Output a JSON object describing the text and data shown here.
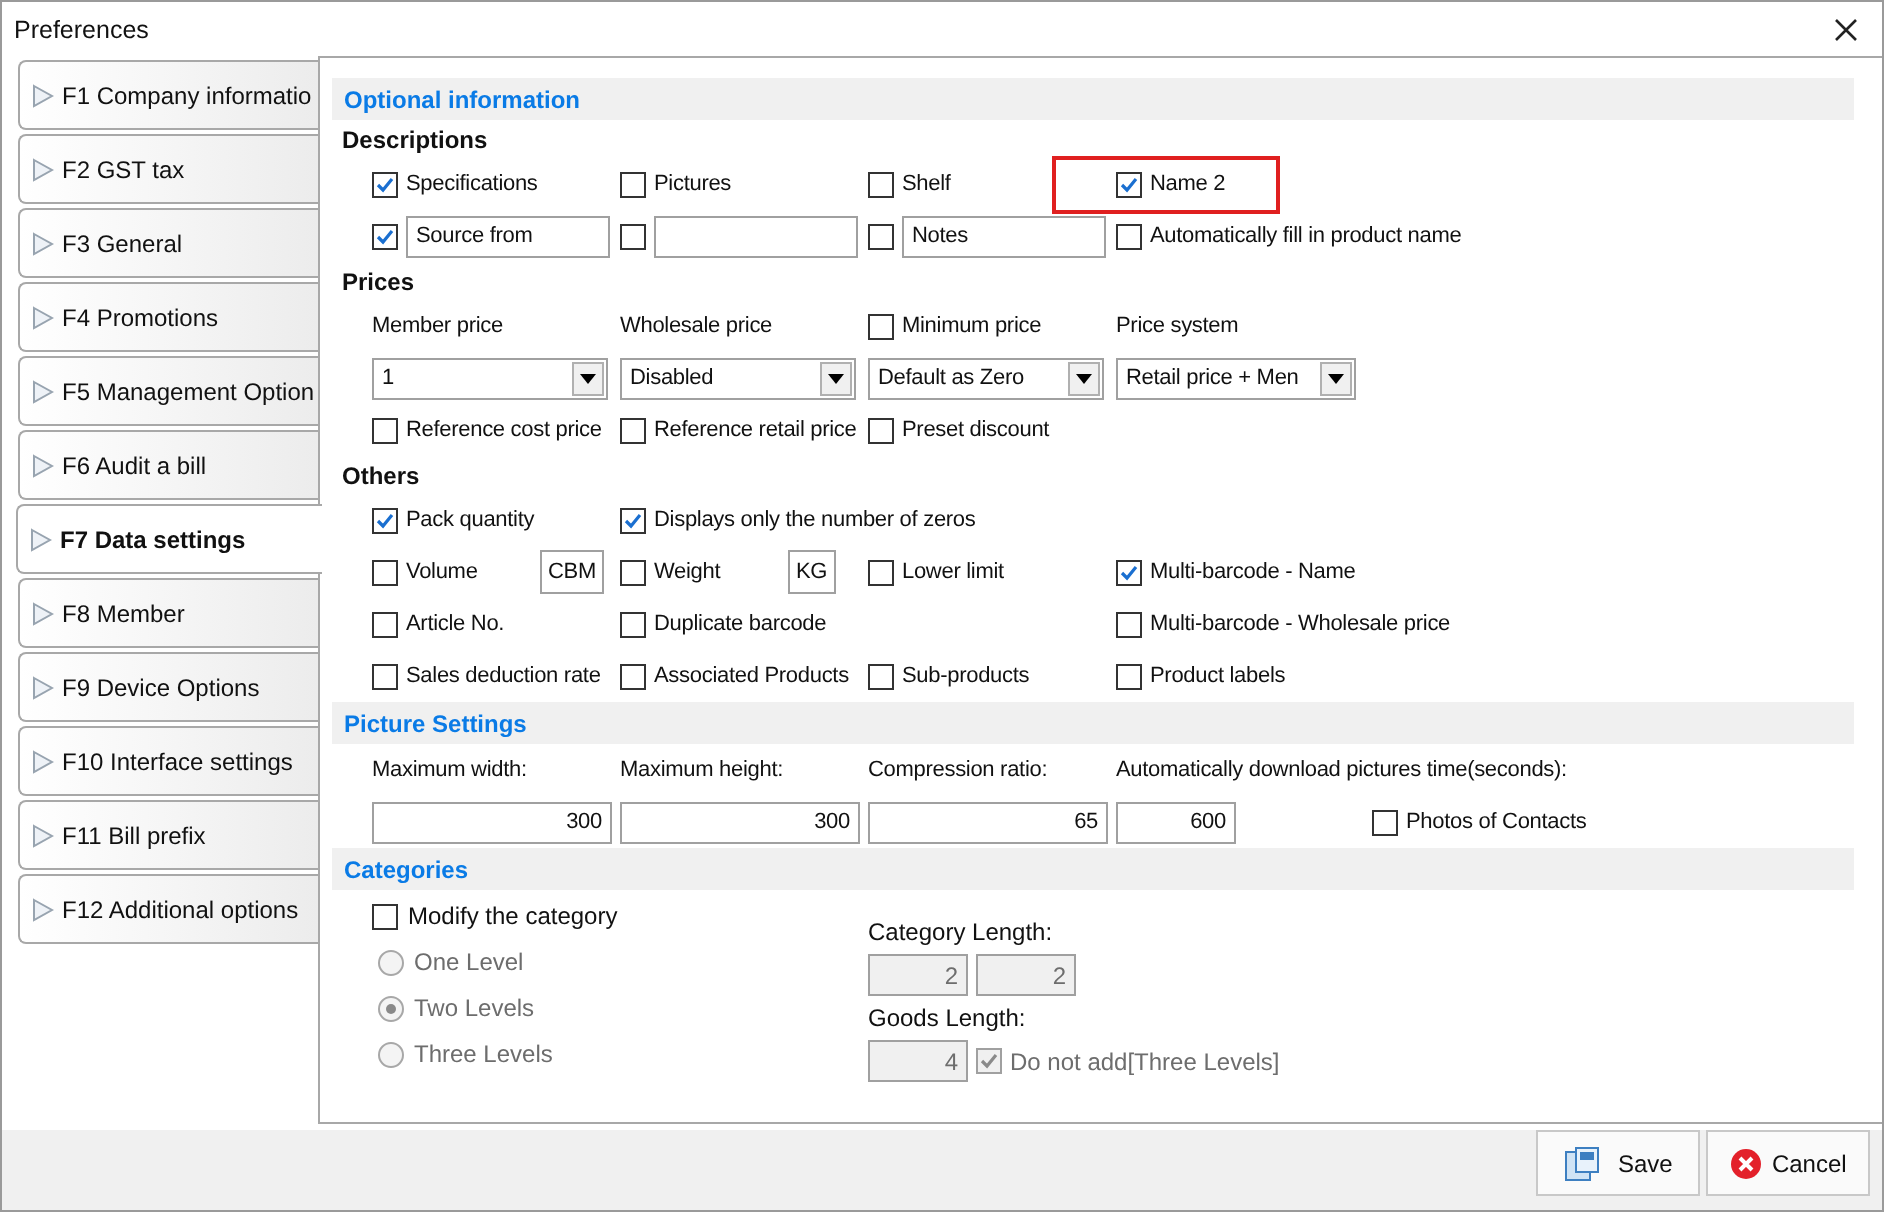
{
  "window": {
    "title": "Preferences"
  },
  "sidebar": {
    "items": [
      {
        "label": "F1 Company informatio",
        "selected": false
      },
      {
        "label": "F2 GST tax",
        "selected": false
      },
      {
        "label": "F3 General",
        "selected": false
      },
      {
        "label": "F4 Promotions",
        "selected": false
      },
      {
        "label": "F5 Management Option",
        "selected": false
      },
      {
        "label": "F6 Audit a bill",
        "selected": false
      },
      {
        "label": "F7 Data settings",
        "selected": true
      },
      {
        "label": "F8 Member",
        "selected": false
      },
      {
        "label": "F9 Device Options",
        "selected": false
      },
      {
        "label": "F10 Interface settings",
        "selected": false
      },
      {
        "label": "F11 Bill prefix",
        "selected": false
      },
      {
        "label": "F12 Additional options",
        "selected": false
      }
    ]
  },
  "sections": [
    {
      "kind": "grid",
      "title": "Optional information",
      "groups": [
        {
          "title": "Descriptions",
          "rows": [
            {
              "cells": [
                {
                  "kind": "check",
                  "label": "Specifications",
                  "checked": true
                },
                {
                  "kind": "check",
                  "label": "Pictures",
                  "checked": false
                },
                {
                  "kind": "check",
                  "label": "Shelf",
                  "checked": false
                },
                {
                  "kind": "check",
                  "label": "Name 2",
                  "checked": true,
                  "highlighted": true
                }
              ]
            },
            {
              "cells": [
                {
                  "kind": "checkfield",
                  "checked": true,
                  "value": "Source from"
                },
                {
                  "kind": "checkfield",
                  "checked": false
                },
                {
                  "kind": "checkfield",
                  "checked": false,
                  "value": "Notes"
                },
                {
                  "kind": "check",
                  "label": "Automatically fill in product name",
                  "checked": false
                }
              ]
            }
          ]
        },
        {
          "title": "Prices",
          "rows": [
            {
              "cells": [
                {
                  "kind": "label",
                  "text": "Member price"
                },
                {
                  "kind": "label",
                  "text": "Wholesale price"
                },
                {
                  "kind": "check",
                  "label": "Minimum price",
                  "checked": false
                },
                {
                  "kind": "label",
                  "text": "Price system"
                }
              ]
            },
            {
              "cells": [
                {
                  "kind": "combo",
                  "value": "1"
                },
                {
                  "kind": "combo",
                  "value": "Disabled"
                },
                {
                  "kind": "combo",
                  "value": "Default as Zero"
                },
                {
                  "kind": "combo",
                  "value": "Retail price + Men"
                }
              ]
            },
            {
              "cells": [
                {
                  "kind": "check",
                  "label": "Reference cost price",
                  "checked": false
                },
                {
                  "kind": "check",
                  "label": "Reference retail price",
                  "checked": false
                },
                {
                  "kind": "check",
                  "label": "Preset discount",
                  "checked": false
                }
              ]
            }
          ]
        },
        {
          "title": "Others",
          "rows": [
            {
              "cells": [
                {
                  "kind": "check",
                  "label": "Pack quantity",
                  "checked": true
                },
                {
                  "kind": "check",
                  "label": "Displays only the number of zeros",
                  "checked": true
                }
              ]
            },
            {
              "cells": [
                {
                  "kind": "checkunit",
                  "label": "Volume",
                  "checked": false,
                  "unit": "CBM"
                },
                {
                  "kind": "checkunit",
                  "label": "Weight",
                  "checked": false,
                  "unit": "KG"
                },
                {
                  "kind": "check",
                  "label": "Lower limit",
                  "checked": false
                },
                {
                  "kind": "check",
                  "label": "Multi-barcode - Name",
                  "checked": true
                }
              ]
            },
            {
              "cells": [
                {
                  "kind": "check",
                  "label": "Article No.",
                  "checked": false
                },
                {
                  "kind": "check",
                  "label": "Duplicate barcode",
                  "checked": false
                },
                {
                  "kind": "blank"
                },
                {
                  "kind": "check",
                  "label": "Multi-barcode - Wholesale price",
                  "checked": false
                }
              ]
            },
            {
              "cells": [
                {
                  "kind": "check",
                  "label": "Sales deduction rate",
                  "checked": false
                },
                {
                  "kind": "check",
                  "label": "Associated Products",
                  "checked": false
                },
                {
                  "kind": "check",
                  "label": "Sub-products",
                  "checked": false
                },
                {
                  "kind": "check",
                  "label": "Product labels",
                  "checked": false
                }
              ]
            }
          ]
        }
      ]
    },
    {
      "kind": "grid",
      "title": "Picture Settings",
      "groups": [
        {
          "rows": [
            {
              "cells": [
                {
                  "kind": "label",
                  "text": "Maximum width:"
                },
                {
                  "kind": "label",
                  "text": "Maximum height:"
                },
                {
                  "kind": "label",
                  "text": "Compression ratio:"
                },
                {
                  "kind": "label",
                  "text": "Automatically download pictures time(seconds):"
                }
              ]
            },
            {
              "cells": [
                {
                  "kind": "number",
                  "value": "300"
                },
                {
                  "kind": "number",
                  "value": "300"
                },
                {
                  "kind": "number",
                  "value": "65"
                },
                {
                  "kind": "numbercheck",
                  "value": "600",
                  "label": "Photos of Contacts",
                  "checked": false
                }
              ]
            }
          ]
        }
      ]
    },
    {
      "kind": "categories",
      "title": "Categories",
      "modify": {
        "label": "Modify the category",
        "checked": false
      },
      "levels": [
        {
          "label": "One Level",
          "selected": false,
          "disabled": true
        },
        {
          "label": "Two Levels",
          "selected": true,
          "disabled": true
        },
        {
          "label": "Three Levels",
          "selected": false,
          "disabled": true
        }
      ],
      "category_length": {
        "label": "Category Length:",
        "values": [
          "2",
          "2"
        ],
        "disabled": true
      },
      "goods_length": {
        "label": "Goods Length:",
        "value": "4",
        "disabled": true,
        "option": {
          "label": "Do not add[Three Levels]",
          "checked": true,
          "disabled": true
        }
      }
    }
  ],
  "buttons": [
    {
      "kind": "save",
      "label": "Save"
    },
    {
      "kind": "cancel",
      "label": "Cancel"
    }
  ]
}
